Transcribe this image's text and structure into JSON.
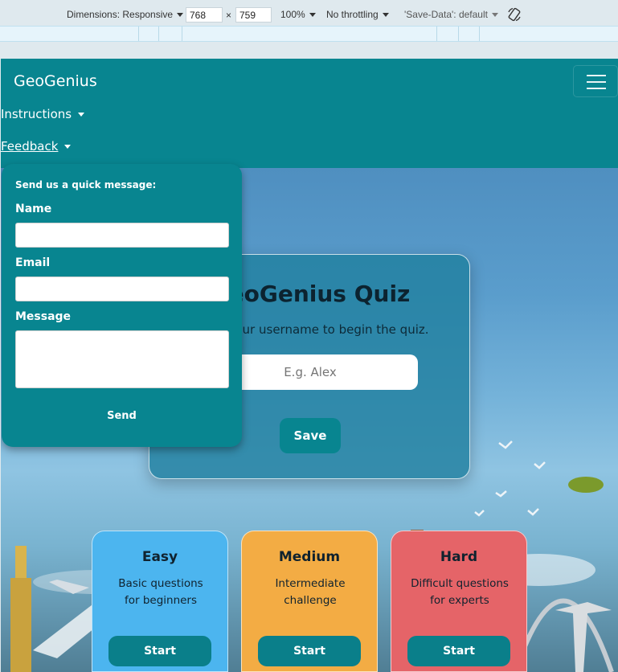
{
  "devtools": {
    "dimensions_label": "Dimensions: Responsive",
    "width_value": "768",
    "times_symbol": "×",
    "height_value": "759",
    "zoom_label": "100%",
    "throttling_label": "No throttling",
    "save_data_label": "'Save-Data': default",
    "rotate_icon": "rotate-icon"
  },
  "navbar": {
    "brand": "GeoGenius",
    "menu_icon": "hamburger-icon",
    "links": [
      {
        "label": "Instructions"
      },
      {
        "label": "Feedback"
      }
    ]
  },
  "feedback_form": {
    "intro": "Send us a quick message:",
    "name_label": "Name",
    "email_label": "Email",
    "message_label": "Message",
    "send_label": "Send",
    "name_value": "",
    "email_value": "",
    "message_value": ""
  },
  "quiz": {
    "title": "GeoGenius Quiz",
    "subtitle": "Enter your username to begin the quiz.",
    "username_placeholder": "E.g. Alex",
    "save_label": "Save"
  },
  "levels": [
    {
      "title": "Easy",
      "desc_line1": "Basic questions",
      "desc_line2": "for beginners",
      "button": "Start",
      "color": "#4cb5ef"
    },
    {
      "title": "Medium",
      "desc_line1": "Intermediate",
      "desc_line2": "challenge",
      "button": "Start",
      "color": "#f3ac44"
    },
    {
      "title": "Hard",
      "desc_line1": "Difficult questions",
      "desc_line2": "for experts",
      "button": "Start",
      "color": "#e56468"
    }
  ]
}
